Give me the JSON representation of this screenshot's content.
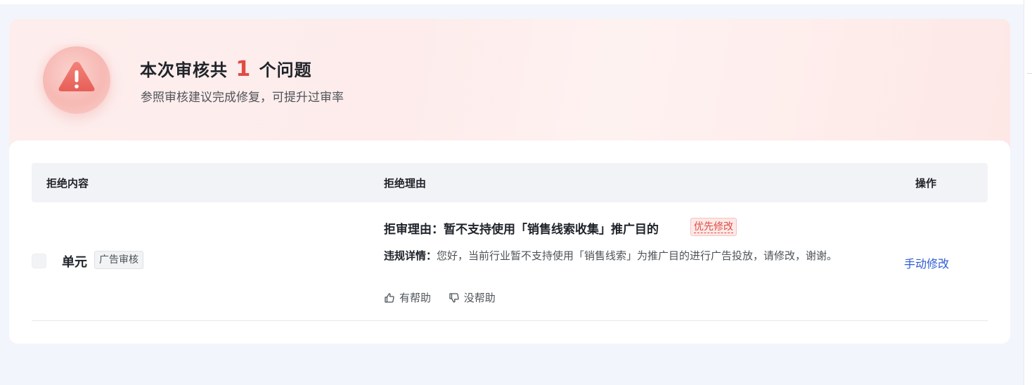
{
  "summary": {
    "title_prefix": "本次审核共",
    "count": "1",
    "title_suffix": "个问题",
    "subtitle": "参照审核建议完成修复，可提升过审率"
  },
  "table": {
    "headers": {
      "content": "拒绝内容",
      "reason": "拒绝理由",
      "action": "操作"
    },
    "rows": [
      {
        "content_label": "单元",
        "content_tag": "广告审核",
        "reason_title": "拒审理由：暂不支持使用「销售线索收集」推广目的",
        "priority_tag": "优先修改",
        "detail_label": "违规详情：",
        "detail_text": "您好，当前行业暂不支持使用「销售线索」为推广目的进行广告投放，请修改，谢谢。",
        "helpful_label": "有帮助",
        "not_helpful_label": "没帮助",
        "action_label": "手动修改"
      }
    ]
  },
  "colors": {
    "accent_red": "#e04b44",
    "link_blue": "#2d5bd3",
    "banner_pink": "#fdeeed"
  },
  "icons": [
    "warning-icon",
    "thumbs-up-icon",
    "thumbs-down-icon"
  ]
}
